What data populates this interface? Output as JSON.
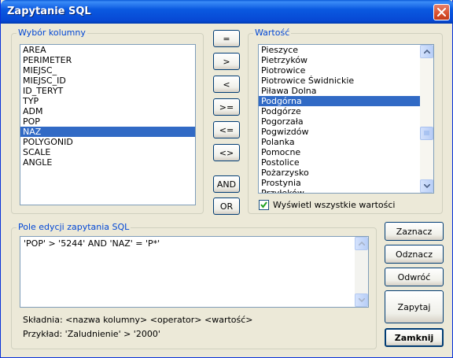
{
  "window": {
    "title": "Zapytanie SQL"
  },
  "columns_group": {
    "legend": "Wybór kolumny",
    "items": [
      "AREA",
      "PERIMETER",
      "MIEJSC_",
      "MIEJSC_ID",
      "ID_TERYT",
      "TYP",
      "ADM",
      "POP",
      "NAZ",
      "POLYGONID",
      "SCALE",
      "ANGLE"
    ],
    "selected": "NAZ"
  },
  "operators": [
    "=",
    ">",
    "<",
    ">=",
    "<=",
    "<>"
  ],
  "logic": {
    "and": "AND",
    "or": "OR"
  },
  "values_group": {
    "legend": "Wartość",
    "items": [
      "Pieszyce",
      "Pietrzyków",
      "Piotrowice",
      "Piotrowice Świdnickie",
      "Piława Dolna",
      "Podgórna",
      "Podgórze",
      "Pogorzała",
      "Pogwizdów",
      "Polanka",
      "Pomocne",
      "Postolice",
      "Pożarzysko",
      "Prostynia",
      "Przyłęków"
    ],
    "selected": "Podgórna",
    "show_all_label": "Wyświetl wszystkie wartości",
    "show_all_checked": true
  },
  "sql_group": {
    "legend": "Pole edycji zapytania SQL",
    "query": "'POP' > '5244' AND 'NAZ' = 'P*'",
    "syntax": "Składnia: <nazwa kolumny> <operator> <wartość>",
    "example": "Przykład: 'Zaludnienie' > '2000'"
  },
  "actions": {
    "select": "Zaznacz",
    "deselect": "Odznacz",
    "invert": "Odwróć",
    "query": "Zapytaj",
    "close": "Zamknij"
  }
}
